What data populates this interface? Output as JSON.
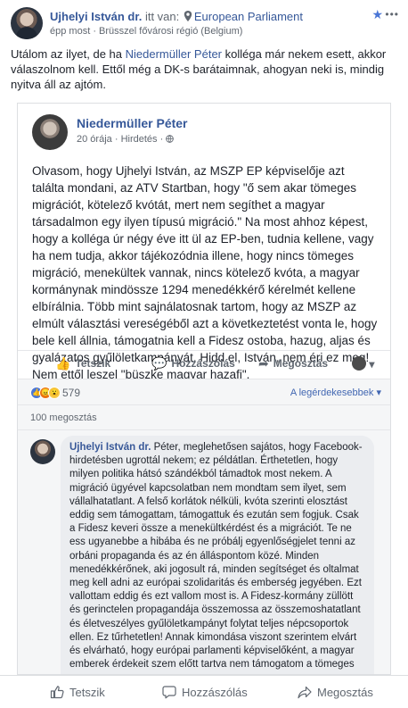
{
  "post": {
    "author": "Ujhelyi István dr.",
    "location_prefix": "itt van:",
    "location": "European Parliament",
    "time": "épp most",
    "region": "Brüsszel fővárosi régió (Belgium)",
    "caption_part1": "Utálom az ilyet, de ha ",
    "caption_link": "Niedermüller Péter",
    "caption_part2": " kolléga már nekem esett, akkor válaszolnom kell. Ettől még a DK-s barátaimnak, ahogyan neki is, mindig nyitva áll az ajtóm."
  },
  "shared": {
    "author": "Niedermüller Péter",
    "time": "20 órája",
    "sponsored": "Hirdetés",
    "body": "Olvasom, hogy Ujhelyi István, az MSZP EP képviselője azt találta mondani, az ATV Startban, hogy \"ő sem akar tömeges migrációt, kötelező kvótát, mert nem segíthet a magyar társadalmon egy ilyen típusú migráció.\" Na most ahhoz képest, hogy a kolléga úr négy éve itt ül az EP-ben, tudnia kellene, vagy ha nem tudja, akkor tájékozódnia illene, hogy nincs tömeges migráció, menekültek vannak, nincs kötelező kvóta, a magyar kormánynak mindössze 1294 menedékkérő kérelmét kellene elbírálnia. Több mint sajnálatosnak tartom, hogy az MSZP az elmúlt választási vereségéből azt a következtetést vonta le, hogy bele kell állnia, támogatnia kell a Fidesz ostoba, hazug, aljas és gyalázatos gyűlöletkampányát. Hidd el, István, nem éri ez meg! Nem ettől leszel \"büszke magyar hazafi\".",
    "like_label": "Tetszik",
    "comment_label": "Hozzászólás",
    "share_label": "Megosztás",
    "reaction_count": "579",
    "sort_label": "A legérdekesebbek",
    "shares_count": "100 megosztás",
    "comment": {
      "author": "Ujhelyi István dr.",
      "text": " Péter, meglehetősen sajátos, hogy Facebook-hirdetésben ugrottál nekem; ez példátlan. Érthetetlen, hogy milyen politika hátsó szándékból támadtok most nekem. A migráció ügyével kapcsolatban nem mondtam sem ilyet, sem vállalhatatlant. A felső korlátok nélküli, kvóta szerinti elosztást eddig sem támogattam, támogattuk és ezután sem fogjuk. Csak a Fidesz keveri össze a menekültkérdést és a migrációt. Te ne ess ugyanebbe a hibába és ne próbálj egyenlőségjelet tenni az orbáni propaganda és az én álláspontom közé. Minden menedékkérőnek, aki jogosult rá, minden segítséget és oltalmat meg kell adni az európai szolidaritás és emberség jegyében. Ezt vallottam eddig és ezt vallom most is. A Fidesz-kormány züllött és gerinctelen propagandája összemossa az összemoshatatlant és életveszélyes gyűlöletkampányt folytat teljes népcsoportok ellen. Ez tűrhetetlen! Annak kimondása viszont szerintem elvárt és elvárható, hogy európai parlamenti képviselőként, a magyar emberek érdekeit szem előtt tartva nem támogatom a tömeges"
    }
  },
  "actions": {
    "like": "Tetszik",
    "comment": "Hozzászólás",
    "share": "Megosztás"
  },
  "colors": {
    "link": "#365899",
    "meta": "#606770",
    "like_blue": "#4a76d6"
  },
  "icons": [
    "star-icon",
    "more-icon",
    "location-pin-icon",
    "globe-icon",
    "like-icon",
    "comment-icon",
    "share-icon"
  ]
}
